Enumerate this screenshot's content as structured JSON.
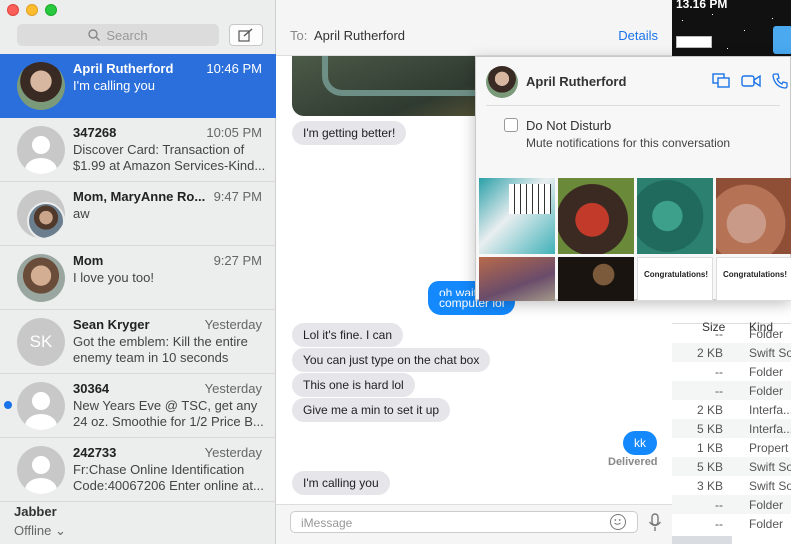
{
  "desktop": {
    "clock": "13.16 PM"
  },
  "window": {
    "controls": [
      "close",
      "minimize",
      "zoom"
    ]
  },
  "sidebar": {
    "search_placeholder": "Search",
    "compose_icon": "compose-icon",
    "conversations": [
      {
        "name": "April Rutherford",
        "time": "10:46 PM",
        "preview": "I'm calling you",
        "active": true,
        "unread": false
      },
      {
        "name": "347268",
        "time": "10:05 PM",
        "preview": "Discover Card: Transaction of $1.99 at Amazon Services-Kind...",
        "active": false,
        "unread": false
      },
      {
        "name": "Mom, MaryAnne Ro...",
        "time": "9:47 PM",
        "preview": "aw",
        "active": false,
        "unread": false
      },
      {
        "name": "Mom",
        "time": "9:27 PM",
        "preview": "I love you too!",
        "active": false,
        "unread": false
      },
      {
        "name": "Sean Kryger",
        "time": "Yesterday",
        "preview": "Got the emblem: Kill the entire enemy team in 10 seconds",
        "active": false,
        "unread": false,
        "initials": "SK"
      },
      {
        "name": "30364",
        "time": "Yesterday",
        "preview": "New Years Eve @ TSC, get any 24 oz. Smoothie for 1/2 Price B...",
        "active": false,
        "unread": true
      },
      {
        "name": "242733",
        "time": "Yesterday",
        "preview": "Fr:Chase Online Identification Code:40067206 Enter online at...",
        "active": false,
        "unread": false
      }
    ],
    "account": {
      "name": "Jabber",
      "status": "Offline ⌄"
    }
  },
  "chat": {
    "to_label": "To:",
    "to_name": "April Rutherford",
    "details_label": "Details",
    "messages": [
      {
        "dir": "in",
        "text": "I'm getting better!"
      },
      {
        "dir": "out",
        "text": "oh wait"
      },
      {
        "dir": "out",
        "text": "computer lol"
      },
      {
        "dir": "in",
        "text": "Lol it's fine. I can"
      },
      {
        "dir": "in",
        "text": "You can just type on the chat box"
      },
      {
        "dir": "in",
        "text": "This one is hard lol"
      },
      {
        "dir": "in",
        "text": "Give me a min to set it up"
      },
      {
        "dir": "out",
        "text": "kk"
      },
      {
        "dir": "in",
        "text": "I'm calling you"
      }
    ],
    "delivered": "Delivered",
    "input_placeholder": "iMessage"
  },
  "details_popover": {
    "name": "April Rutherford",
    "dnd_label": "Do Not Disturb",
    "dnd_desc": "Mute notifications for this conversation",
    "thumb_text": [
      "Congratulations!",
      "Congratulations!"
    ]
  },
  "finder": {
    "headers": {
      "size": "Size",
      "kind": "Kind"
    },
    "rows": [
      {
        "size": "--",
        "kind": "Folder"
      },
      {
        "size": "2 KB",
        "kind": "Swift So"
      },
      {
        "size": "--",
        "kind": "Folder"
      },
      {
        "size": "--",
        "kind": "Folder"
      },
      {
        "size": "2 KB",
        "kind": "Interfa..."
      },
      {
        "size": "5 KB",
        "kind": "Interfa..."
      },
      {
        "size": "1 KB",
        "kind": "Propert"
      },
      {
        "size": "5 KB",
        "kind": "Swift So"
      },
      {
        "size": "3 KB",
        "kind": "Swift So"
      },
      {
        "size": "--",
        "kind": "Folder"
      },
      {
        "size": "--",
        "kind": "Folder"
      }
    ]
  }
}
